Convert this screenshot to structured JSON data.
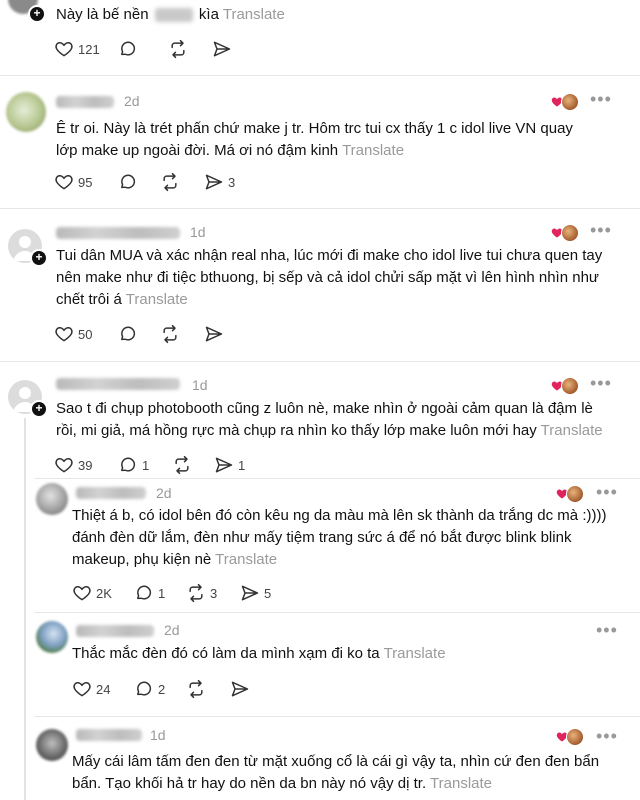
{
  "posts": [
    {
      "text_before": "Này là bế nền",
      "text_after": "kìa",
      "translate": "Translate",
      "likes": "121"
    },
    {
      "time": "2d",
      "text": "Ê tr oi. Này là trét phấn chứ make j tr. Hôm trc tui cx thấy 1 c idol live VN quay lớp make up ngoài đời. Má ơi nó đậm kinh",
      "translate": "Translate",
      "likes": "95",
      "shares": "3"
    },
    {
      "time": "1d",
      "text": "Tui dân MUA và xác nhận real nha, lúc mới đi make cho idol live tui chưa quen tay nên make như đi tiệc bthuong, bị sếp và cả idol chửi sấp mặt vì lên hình nhìn như chết trôi á",
      "translate": "Translate",
      "likes": "50"
    },
    {
      "time": "1d",
      "text": "Sao t đi chụp photobooth cũng z luôn nè, make nhìn ở ngoài cảm quan là đậm lè rồi, mi giả, má hồng rực mà chụp ra nhìn ko thấy lớp make luôn mới hay",
      "translate": "Translate",
      "likes": "39",
      "replies": "1",
      "shares": "1"
    },
    {
      "time": "2d",
      "text": "Thiệt á b, có idol bên đó còn kêu ng da màu mà lên sk thành da trắng dc mà :)))) đánh đèn dữ lắm, đèn như mấy tiệm trang sức á để nó bắt được blink blink makeup, phụ kiện nè",
      "translate": "Translate",
      "likes": "2K",
      "replies": "1",
      "reposts": "3",
      "shares": "5"
    },
    {
      "time": "2d",
      "text": "Thắc mắc đèn đó có làm da mình xạm đi ko ta",
      "translate": "Translate",
      "likes": "24",
      "replies": "2"
    },
    {
      "time": "1d",
      "text": "Mấy cái lâm tấm đen đen từ mặt xuống cổ là cái gì vậy ta, nhìn cứ đen đen bẩn bẩn. Tạo khối hả tr hay do nền da bn này nó vậy dị tr.",
      "translate": "Translate"
    }
  ],
  "icons": {
    "like": "heart-outline-icon",
    "reply": "comment-bubble-icon",
    "repost": "repost-arrows-icon",
    "share": "send-paper-plane-icon",
    "more": "more-dots-icon"
  },
  "colors": {
    "heart_red": "#e0245e",
    "muted": "#999999"
  }
}
